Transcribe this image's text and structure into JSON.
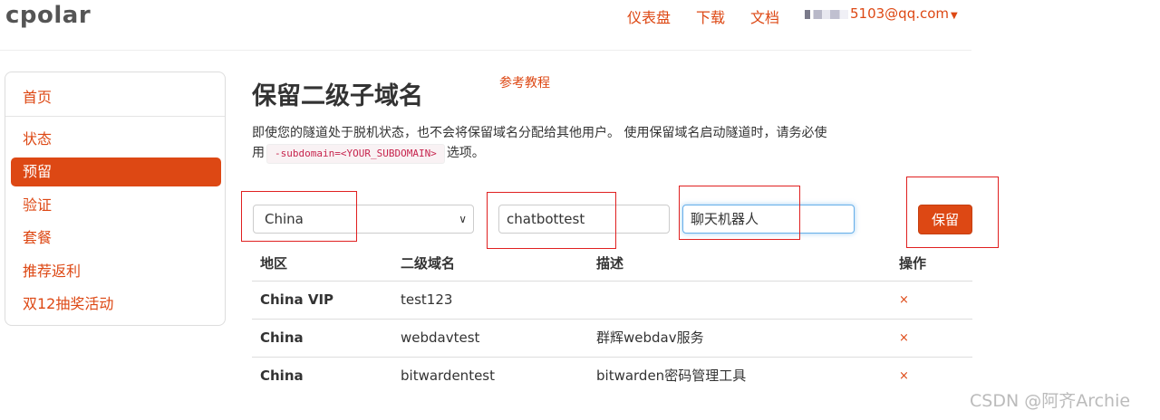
{
  "brand": {
    "logo": "cpolar"
  },
  "topnav": {
    "links": [
      "仪表盘",
      "下载",
      "文档"
    ],
    "user_email": "5103@qq.com"
  },
  "sidebar": {
    "home": "首页",
    "items": [
      {
        "label": "状态",
        "active": false
      },
      {
        "label": "预留",
        "active": true
      },
      {
        "label": "验证",
        "active": false
      },
      {
        "label": "套餐",
        "active": false
      },
      {
        "label": "推荐返利",
        "active": false
      },
      {
        "label": "双12抽奖活动",
        "active": false
      }
    ]
  },
  "main": {
    "title": "保留二级子域名",
    "ref_link": "参考教程",
    "desc_part1": "即使您的隧道处于脱机状态，也不会将保留域名分配给其他用户。 使用保留域名启动隧道时，请务必使用",
    "desc_code": "-subdomain=<YOUR_SUBDOMAIN>",
    "desc_part2": "选项。"
  },
  "form": {
    "region_value": "China",
    "subdomain_value": "chatbottest",
    "description_value": "聊天机器人",
    "save_label": "保留"
  },
  "table": {
    "headers": [
      "地区",
      "二级域名",
      "描述",
      "操作"
    ],
    "rows": [
      {
        "region": "China VIP",
        "subdomain": "test123",
        "description": "",
        "action": "×"
      },
      {
        "region": "China",
        "subdomain": "webdavtest",
        "description": "群辉webdav服务",
        "action": "×"
      },
      {
        "region": "China",
        "subdomain": "bitwardentest",
        "description": "bitwarden密码管理工具",
        "action": "×"
      }
    ]
  },
  "watermark": "CSDN @阿齐Archie",
  "colors": {
    "accent": "#dd4814",
    "annotation_box": "#e02020"
  }
}
